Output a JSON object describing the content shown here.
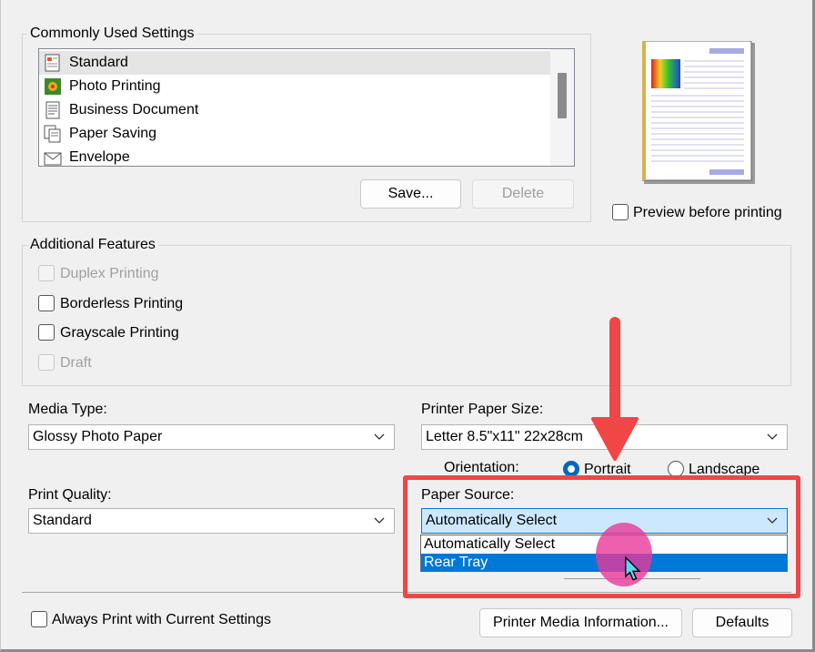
{
  "common": {
    "title": "Commonly Used Settings",
    "items": [
      {
        "label": "Standard",
        "icon": "standard-doc-icon",
        "selected": true
      },
      {
        "label": "Photo Printing",
        "icon": "photo-icon",
        "selected": false
      },
      {
        "label": "Business Document",
        "icon": "business-doc-icon",
        "selected": false
      },
      {
        "label": "Paper Saving",
        "icon": "paper-saving-icon",
        "selected": false
      },
      {
        "label": "Envelope",
        "icon": "envelope-icon",
        "selected": false
      }
    ],
    "save_label": "Save...",
    "delete_label": "Delete"
  },
  "preview": {
    "label": "Preview before printing",
    "checked": false
  },
  "additional": {
    "title": "Additional Features",
    "options": [
      {
        "label": "Duplex Printing",
        "checked": false,
        "disabled": true
      },
      {
        "label": "Borderless Printing",
        "checked": false,
        "disabled": false
      },
      {
        "label": "Grayscale Printing",
        "checked": false,
        "disabled": false
      },
      {
        "label": "Draft",
        "checked": false,
        "disabled": true
      }
    ]
  },
  "media_type": {
    "label": "Media Type:",
    "value": "Glossy Photo Paper"
  },
  "paper_size": {
    "label": "Printer Paper Size:",
    "value": "Letter 8.5\"x11\" 22x28cm"
  },
  "orientation": {
    "label": "Orientation:",
    "portrait": "Portrait",
    "landscape": "Landscape",
    "selected": "Portrait"
  },
  "print_quality": {
    "label": "Print Quality:",
    "value": "Standard"
  },
  "paper_source": {
    "label": "Paper Source:",
    "value": "Automatically Select",
    "options": [
      "Automatically Select",
      "Rear Tray"
    ],
    "highlighted": "Rear Tray"
  },
  "footer": {
    "always_label": "Always Print with Current Settings",
    "media_info_label": "Printer Media Information...",
    "defaults_label": "Defaults"
  },
  "colors": {
    "annotation_red": "#f04646",
    "selection_blue": "#0078d7",
    "radio_blue": "#0067c0",
    "combo_highlight": "#cce8ff",
    "cursor_highlight": "#e8389a"
  }
}
